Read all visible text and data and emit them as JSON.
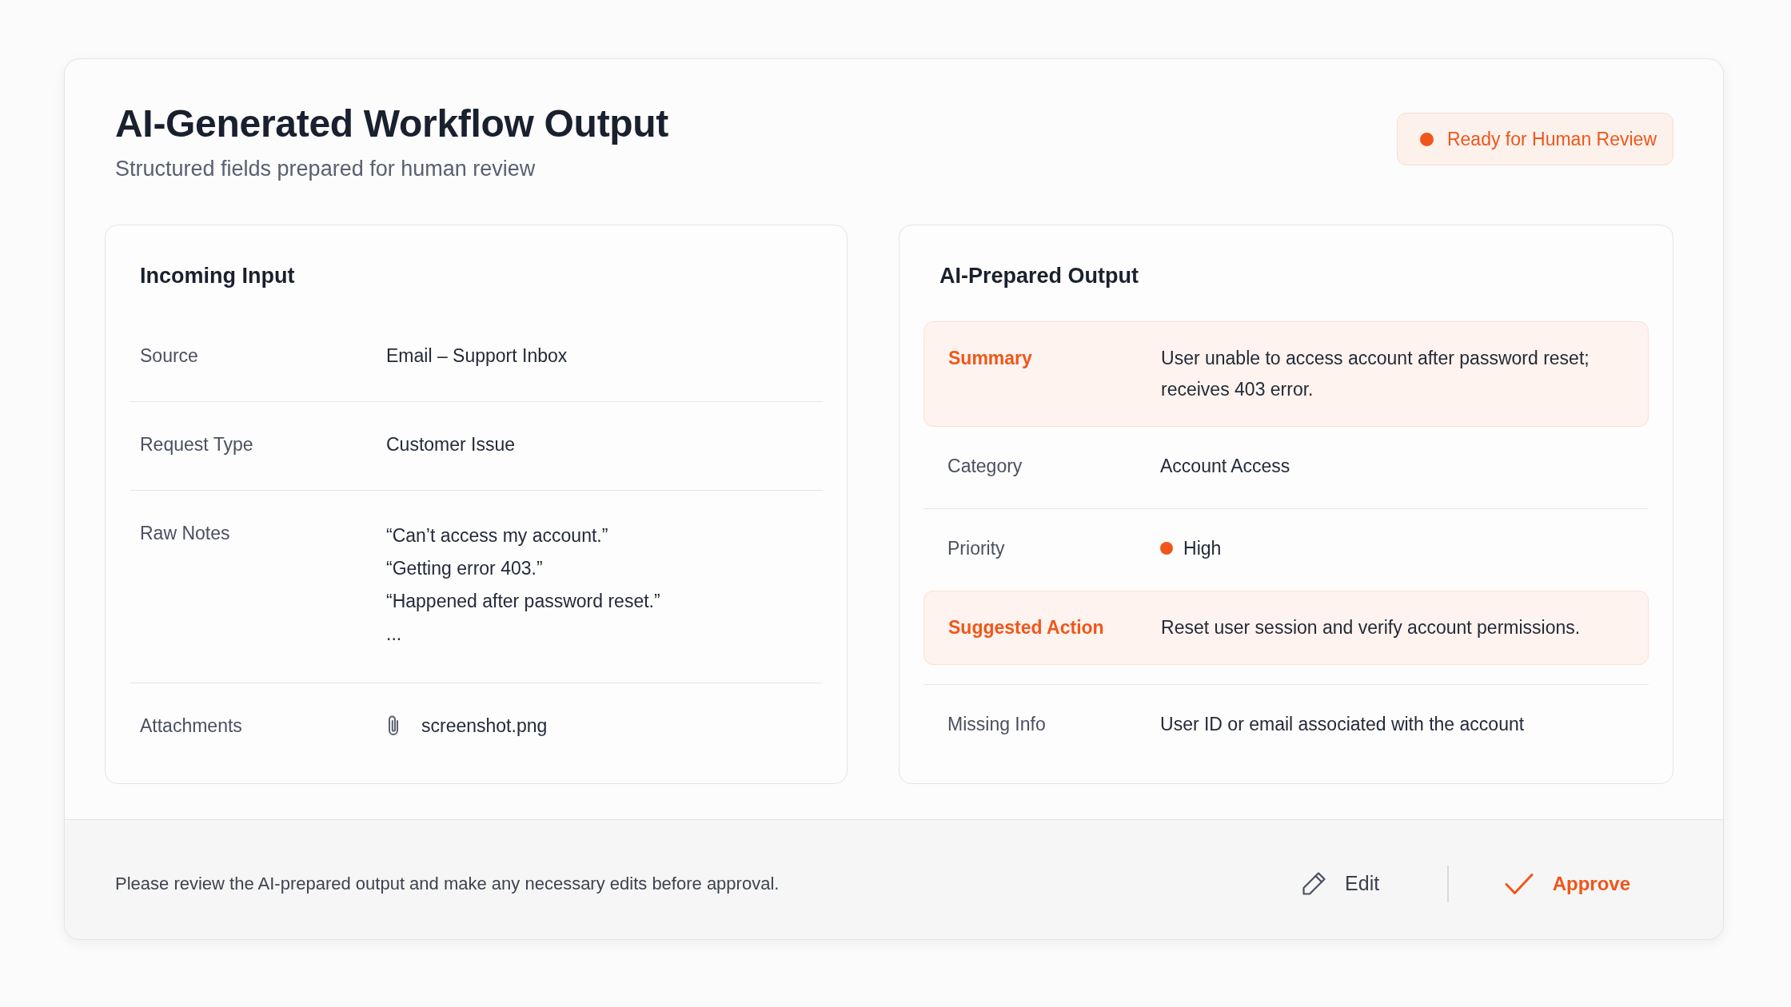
{
  "header": {
    "title": "AI-Generated Workflow Output",
    "subtitle": "Structured fields prepared for human review",
    "status": {
      "label": "Ready for Human Review",
      "color": "#f0561a"
    }
  },
  "panels": [
    {
      "title": "Incoming Input",
      "fields": [
        {
          "kind": "text",
          "label": "Source",
          "value": "Email – Support Inbox",
          "highlighted": false,
          "rule_below": true
        },
        {
          "kind": "text",
          "label": "Request Type",
          "value": "Customer Issue",
          "highlighted": false,
          "rule_below": true
        },
        {
          "kind": "lines",
          "label": "Raw Notes",
          "lines": [
            "“Can’t access my account.”",
            "“Getting error 403.”",
            "“Happened after password reset.”",
            "..."
          ],
          "highlighted": false,
          "rule_below": true
        },
        {
          "kind": "attachment",
          "label": "Attachments",
          "value": "screenshot.png",
          "highlighted": false,
          "rule_below": false
        }
      ]
    },
    {
      "title": "AI-Prepared Output",
      "fields": [
        {
          "kind": "text",
          "label": "Summary",
          "value": "User unable to access account after password reset; receives 403 error.",
          "highlighted": true,
          "rule_below": false
        },
        {
          "kind": "text",
          "label": "Category",
          "value": "Account Access",
          "highlighted": false,
          "rule_below": true
        },
        {
          "kind": "priority",
          "label": "Priority",
          "value": "High",
          "color": "#f0561a",
          "highlighted": false,
          "rule_below": false
        },
        {
          "kind": "text",
          "label": "Suggested Action",
          "value": "Reset user session and verify account permissions.",
          "highlighted": true,
          "rule_below": true
        },
        {
          "kind": "text",
          "label": "Missing Info",
          "value": "User ID or email associated with the account",
          "highlighted": false,
          "rule_below": false
        }
      ]
    }
  ],
  "footer": {
    "note": "Please review the AI-prepared output and make any necessary edits before approval.",
    "actions": [
      {
        "kind": "edit",
        "label": "Edit"
      },
      {
        "kind": "approve",
        "label": "Approve"
      }
    ]
  }
}
